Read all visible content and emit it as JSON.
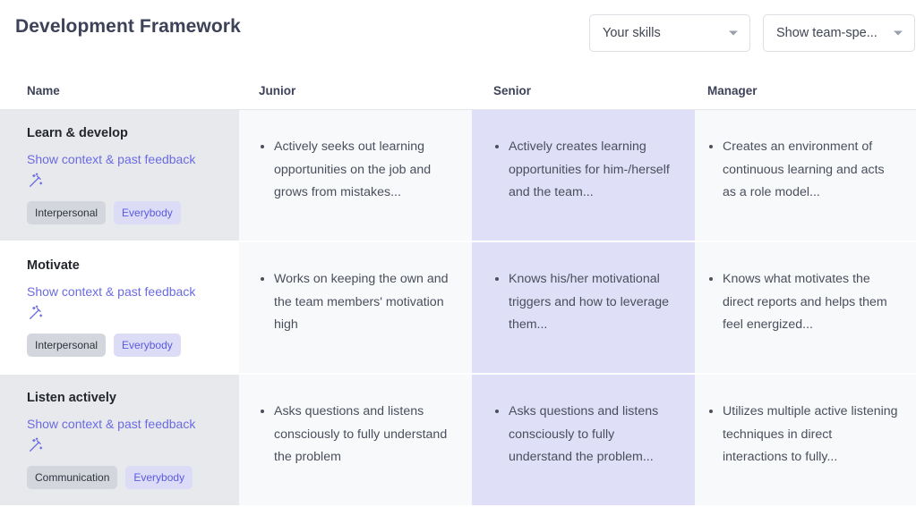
{
  "header": {
    "title": "Development Framework",
    "filters": [
      {
        "name": "skills-scope-select",
        "value": "Your skills",
        "icon": "chevron-down-icon"
      },
      {
        "name": "team-visibility-select",
        "value": "Show team-spe...",
        "icon": "chevron-down-icon"
      }
    ]
  },
  "table": {
    "columns": [
      "Name",
      "Junior",
      "Senior",
      "Manager"
    ],
    "highlighted_column": "Senior",
    "context_link_label": "Show context & past feedback",
    "wand_icon": "magic-wand-icon",
    "rows": [
      {
        "name": "Learn & develop",
        "shaded": true,
        "tags": [
          {
            "label": "Interpersonal",
            "style": "grey"
          },
          {
            "label": "Everybody",
            "style": "purple"
          }
        ],
        "junior": "Actively seeks out learning opportunities on the job and grows from mistakes...",
        "senior": "Actively creates learning opportunities for him-/herself and the team...",
        "manager": "Creates an environment of continuous learning and acts as a role model..."
      },
      {
        "name": "Motivate",
        "shaded": false,
        "tags": [
          {
            "label": "Interpersonal",
            "style": "grey"
          },
          {
            "label": "Everybody",
            "style": "purple"
          }
        ],
        "junior": "Works on keeping the own and the team members' motivation high",
        "senior": "Knows his/her motivational triggers and how to leverage them...",
        "manager": "Knows what motivates the direct reports and helps them feel energized..."
      },
      {
        "name": "Listen actively",
        "shaded": true,
        "tags": [
          {
            "label": "Communication",
            "style": "grey"
          },
          {
            "label": "Everybody",
            "style": "purple"
          }
        ],
        "junior": "Asks questions and listens consciously to fully understand the problem",
        "senior": "Asks questions and listens consciously to fully understand the problem...",
        "manager": "Utilizes multiple active listening techniques in direct interactions to fully..."
      }
    ]
  },
  "colors": {
    "accent": "#6b6be0",
    "highlight_column_bg": "#dfdff7",
    "shaded_name_bg": "#e7e9ed",
    "content_bg": "#f8f9fb"
  }
}
